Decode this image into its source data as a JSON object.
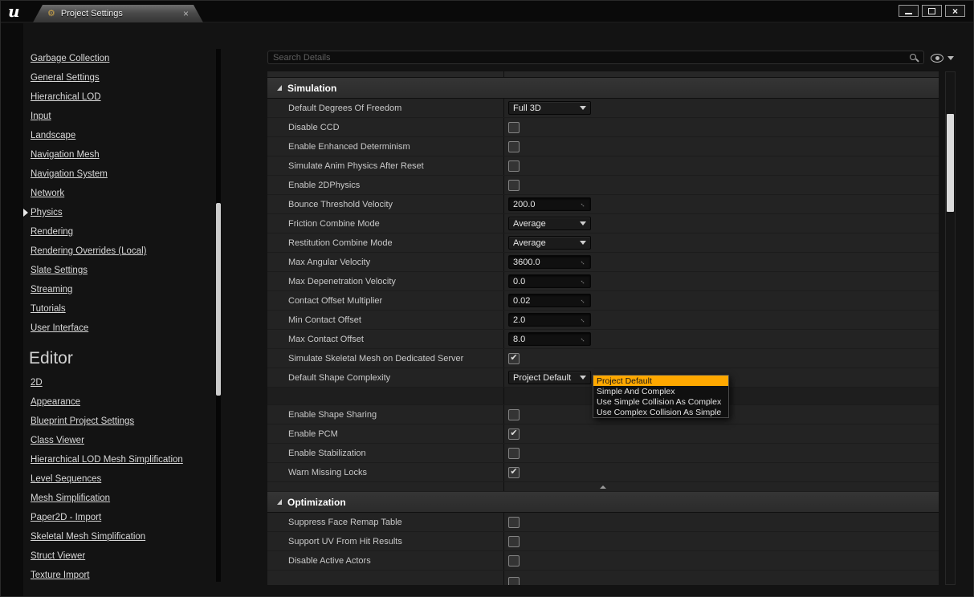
{
  "window": {
    "logo": "u",
    "tab_label": "Project Settings"
  },
  "icons": {
    "gear": "⚙",
    "close": "×",
    "check": "✔",
    "diag_arrow": "↔"
  },
  "colors": {
    "accent": "#FFA800",
    "accent_text": "#151515"
  },
  "sidebar": {
    "engine_items": [
      {
        "label": "Garbage Collection"
      },
      {
        "label": "General Settings"
      },
      {
        "label": "Hierarchical LOD"
      },
      {
        "label": "Input"
      },
      {
        "label": "Landscape"
      },
      {
        "label": "Navigation Mesh"
      },
      {
        "label": "Navigation System"
      },
      {
        "label": "Network"
      },
      {
        "label": "Physics",
        "selected": true
      },
      {
        "label": "Rendering"
      },
      {
        "label": "Rendering Overrides (Local)"
      },
      {
        "label": "Slate Settings"
      },
      {
        "label": "Streaming"
      },
      {
        "label": "Tutorials"
      },
      {
        "label": "User Interface"
      }
    ],
    "section_header": "Editor",
    "editor_items": [
      {
        "label": "2D"
      },
      {
        "label": "Appearance"
      },
      {
        "label": "Blueprint Project Settings"
      },
      {
        "label": "Class Viewer"
      },
      {
        "label": "Hierarchical LOD Mesh Simplification"
      },
      {
        "label": "Level Sequences"
      },
      {
        "label": "Mesh Simplification"
      },
      {
        "label": "Paper2D - Import"
      },
      {
        "label": "Skeletal Mesh Simplification"
      },
      {
        "label": "Struct Viewer"
      },
      {
        "label": "Texture Import"
      }
    ]
  },
  "details": {
    "search_placeholder": "Search Details",
    "sections": [
      {
        "title": "Simulation",
        "rows": [
          {
            "label": "Default Degrees Of Freedom",
            "type": "combo",
            "value": "Full 3D"
          },
          {
            "label": "Disable CCD",
            "type": "checkbox",
            "checked": false
          },
          {
            "label": "Enable Enhanced Determinism",
            "type": "checkbox",
            "checked": false
          },
          {
            "label": "Simulate Anim Physics After Reset",
            "type": "checkbox",
            "checked": false
          },
          {
            "label": "Enable 2DPhysics",
            "type": "checkbox",
            "checked": false
          },
          {
            "label": "Bounce Threshold Velocity",
            "type": "number",
            "value": "200.0"
          },
          {
            "label": "Friction Combine Mode",
            "type": "combo",
            "value": "Average"
          },
          {
            "label": "Restitution Combine Mode",
            "type": "combo",
            "value": "Average"
          },
          {
            "label": "Max Angular Velocity",
            "type": "number",
            "value": "3600.0"
          },
          {
            "label": "Max Depenetration Velocity",
            "type": "number",
            "value": "0.0"
          },
          {
            "label": "Contact Offset Multiplier",
            "type": "number",
            "value": "0.02"
          },
          {
            "label": "Min Contact Offset",
            "type": "number",
            "value": "2.0"
          },
          {
            "label": "Max Contact Offset",
            "type": "number",
            "value": "8.0"
          },
          {
            "label": "Simulate Skeletal Mesh on Dedicated Server",
            "type": "checkbox",
            "checked": true
          },
          {
            "label": "Default Shape Complexity",
            "type": "combo",
            "value": "Project Default",
            "open": true
          },
          {
            "type": "spacer"
          },
          {
            "label": "Enable Shape Sharing",
            "type": "checkbox",
            "checked": false
          },
          {
            "label": "Enable PCM",
            "type": "checkbox",
            "checked": true
          },
          {
            "label": "Enable Stabilization",
            "type": "checkbox",
            "checked": false
          },
          {
            "label": "Warn Missing Locks",
            "type": "checkbox",
            "checked": true
          },
          {
            "type": "expander"
          }
        ]
      },
      {
        "title": "Optimization",
        "rows": [
          {
            "label": "Suppress Face Remap Table",
            "type": "checkbox",
            "checked": false
          },
          {
            "label": "Support UV From Hit Results",
            "type": "checkbox",
            "checked": false
          },
          {
            "label": "Disable Active Actors",
            "type": "checkbox",
            "checked": false
          },
          {
            "type": "partial"
          }
        ]
      }
    ],
    "dropdown": {
      "items": [
        "Project Default",
        "Simple And Complex",
        "Use Simple Collision As Complex",
        "Use Complex Collision As Simple"
      ],
      "selected_index": 0
    }
  }
}
